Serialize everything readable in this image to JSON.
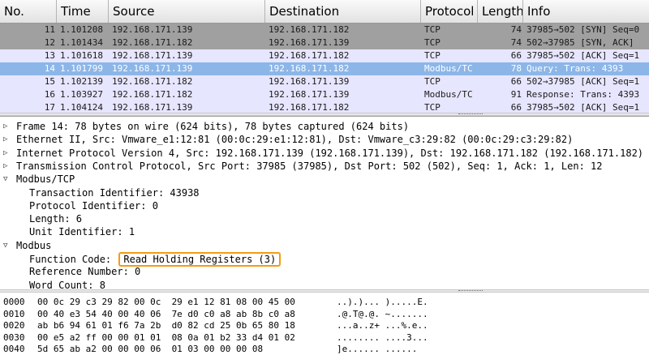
{
  "packet_list": {
    "columns": [
      {
        "key": "no",
        "label": "No."
      },
      {
        "key": "time",
        "label": "Time"
      },
      {
        "key": "source",
        "label": "Source"
      },
      {
        "key": "destination",
        "label": "Destination"
      },
      {
        "key": "protocol",
        "label": "Protocol"
      },
      {
        "key": "length",
        "label": "Length"
      },
      {
        "key": "info",
        "label": "Info"
      }
    ],
    "rows": [
      {
        "no": "11",
        "time": "1.101208",
        "source": "192.168.171.139",
        "destination": "192.168.171.182",
        "protocol": "TCP",
        "length": "74",
        "info": "37985→502 [SYN] Seq=0",
        "bg": "#a0a0a0",
        "fg": "#1a1a1a"
      },
      {
        "no": "12",
        "time": "1.101434",
        "source": "192.168.171.182",
        "destination": "192.168.171.139",
        "protocol": "TCP",
        "length": "74",
        "info": "502→37985 [SYN, ACK]",
        "bg": "#a0a0a0",
        "fg": "#1a1a1a"
      },
      {
        "no": "13",
        "time": "1.101618",
        "source": "192.168.171.139",
        "destination": "192.168.171.182",
        "protocol": "TCP",
        "length": "66",
        "info": "37985→502 [ACK] Seq=1",
        "bg": "#e7e6ff",
        "fg": "#1a1a1a"
      },
      {
        "no": "14",
        "time": "1.101799",
        "source": "192.168.171.139",
        "destination": "192.168.171.182",
        "protocol": "Modbus/TC",
        "length": "78",
        "info": "Query: Trans: 4393",
        "bg": "#8cb6e8",
        "fg": "#ffffff"
      },
      {
        "no": "15",
        "time": "1.102139",
        "source": "192.168.171.182",
        "destination": "192.168.171.139",
        "protocol": "TCP",
        "length": "66",
        "info": "502→37985 [ACK] Seq=1",
        "bg": "#e7e6ff",
        "fg": "#1a1a1a"
      },
      {
        "no": "16",
        "time": "1.103927",
        "source": "192.168.171.182",
        "destination": "192.168.171.139",
        "protocol": "Modbus/TC",
        "length": "91",
        "info": "Response: Trans: 4393",
        "bg": "#e7e6ff",
        "fg": "#1a1a1a"
      },
      {
        "no": "17",
        "time": "1.104124",
        "source": "192.168.171.139",
        "destination": "192.168.171.182",
        "protocol": "TCP",
        "length": "66",
        "info": "37985→502 [ACK] Seq=1",
        "bg": "#e7e6ff",
        "fg": "#1a1a1a"
      }
    ]
  },
  "details": {
    "rows": [
      {
        "indent": 0,
        "toggle": "collapsed-icon",
        "text": "Frame 14: 78 bytes on wire (624 bits), 78 bytes captured (624 bits)",
        "section": true
      },
      {
        "indent": 0,
        "toggle": "collapsed-icon",
        "text": "Ethernet II, Src: Vmware_e1:12:81 (00:0c:29:e1:12:81), Dst: Vmware_c3:29:82 (00:0c:29:c3:29:82)",
        "section": true
      },
      {
        "indent": 0,
        "toggle": "collapsed-icon",
        "text": "Internet Protocol Version 4, Src: 192.168.171.139 (192.168.171.139), Dst: 192.168.171.182 (192.168.171.182)",
        "section": true
      },
      {
        "indent": 0,
        "toggle": "collapsed-icon",
        "text": "Transmission Control Protocol, Src Port: 37985 (37985), Dst Port: 502 (502), Seq: 1, Ack: 1, Len: 12",
        "section": true
      },
      {
        "indent": 0,
        "toggle": "expanded-icon",
        "text": "Modbus/TCP",
        "section": true
      },
      {
        "indent": 1,
        "toggle": "",
        "text": "Transaction Identifier: 43938"
      },
      {
        "indent": 1,
        "toggle": "",
        "text": "Protocol Identifier: 0"
      },
      {
        "indent": 1,
        "toggle": "",
        "text": "Length: 6"
      },
      {
        "indent": 1,
        "toggle": "",
        "text": "Unit Identifier: 1"
      },
      {
        "indent": 0,
        "toggle": "expanded-icon",
        "text": "Modbus",
        "section": true
      },
      {
        "indent": 1,
        "toggle": "",
        "text": "Function Code: ",
        "highlight": "Read Holding Registers (3)"
      },
      {
        "indent": 1,
        "toggle": "",
        "text": "Reference Number: 0"
      },
      {
        "indent": 1,
        "toggle": "",
        "text": "Word Count: 8"
      }
    ]
  },
  "hex": {
    "rows": [
      {
        "offset": "0000",
        "bytes": "00 0c 29 c3 29 82 00 0c  29 e1 12 81 08 00 45 00",
        "ascii": "..).)... ).....E."
      },
      {
        "offset": "0010",
        "bytes": "00 40 e3 54 40 00 40 06  7e d0 c0 a8 ab 8b c0 a8",
        "ascii": ".@.T@.@. ~......."
      },
      {
        "offset": "0020",
        "bytes": "ab b6 94 61 01 f6 7a 2b  d0 82 cd 25 0b 65 80 18",
        "ascii": "...a..z+ ...%.e.."
      },
      {
        "offset": "0030",
        "bytes": "00 e5 a2 ff 00 00 01 01  08 0a 01 b2 33 d4 01 02",
        "ascii": "........ ....3..."
      },
      {
        "offset": "0040",
        "bytes": "5d 65 ab a2 00 00 00 06  01 03 00 00 00 08",
        "ascii": "]e...... ......"
      }
    ]
  },
  "colors": {
    "highlight_box": "#f39c12",
    "selected_row": "#8cb6e8",
    "tcp_syn_row": "#a0a0a0",
    "tcp_row": "#e7e6ff"
  }
}
